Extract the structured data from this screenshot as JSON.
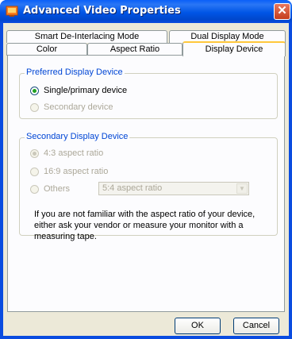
{
  "window": {
    "title": "Advanced Video Properties",
    "close_glyph": "✕",
    "title_color": "#0055e5"
  },
  "tabs": {
    "row_top": [
      "Smart De-Interlacing Mode",
      "Dual Display Mode"
    ],
    "row_bottom": [
      "Color",
      "Aspect Ratio",
      "Display Device"
    ],
    "active": "Display Device"
  },
  "preferred": {
    "title": "Preferred Display Device",
    "options": [
      "Single/primary device",
      "Secondary device"
    ],
    "selected": "Single/primary device"
  },
  "secondary": {
    "title": "Secondary Display Device",
    "options": [
      "4:3 aspect ratio",
      "16:9 aspect ratio",
      "Others"
    ],
    "selected": "4:3 aspect ratio",
    "others_select_value": "5:4 aspect ratio",
    "info": "If you are not familiar with the aspect ratio of your device, either ask your vendor or measure your monitor with a measuring tape."
  },
  "buttons": {
    "ok": "OK",
    "cancel": "Cancel"
  },
  "colors": {
    "accent_green": "#21a121",
    "group_title": "#0046d5",
    "active_tab_accent": "#ffc83c"
  }
}
